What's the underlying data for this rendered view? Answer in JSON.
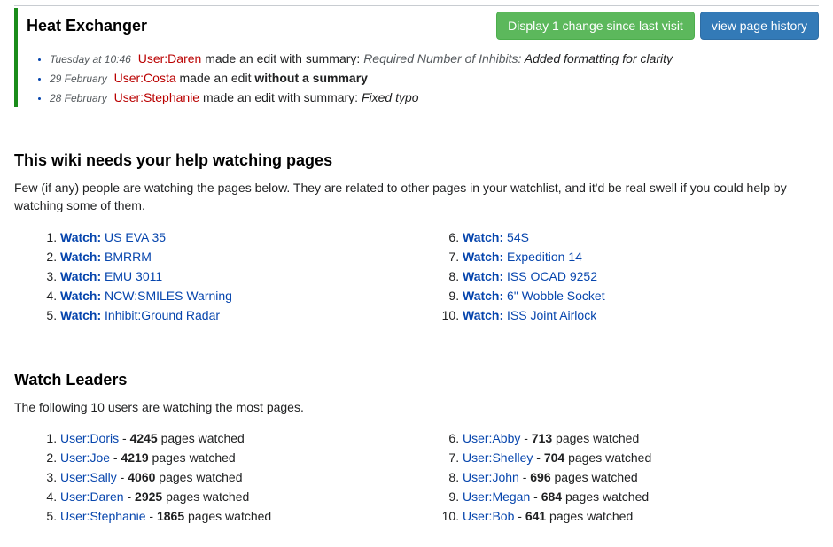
{
  "article": {
    "title": "Heat Exchanger",
    "btn_changes": "Display 1 change since last visit",
    "btn_history": "view page history",
    "edits": [
      {
        "ts": "Tuesday at 10:46",
        "user": "User:Daren",
        "mid": " made an edit with summary:  ",
        "no_summary": "",
        "summary_pre": "Required Number of Inhibits: ",
        "summary_suf": "Added formatting for clarity"
      },
      {
        "ts": "29 February",
        "user": "User:Costa",
        "mid": " made an edit ",
        "no_summary": "without a summary",
        "summary_pre": "",
        "summary_suf": ""
      },
      {
        "ts": "28 February",
        "user": "User:Stephanie",
        "mid": " made an edit with summary:  ",
        "no_summary": "",
        "summary_pre": "",
        "summary_suf": "Fixed typo"
      }
    ]
  },
  "help": {
    "heading": "This wiki needs your help watching pages",
    "lead": "Few (if any) people are watching the pages below. They are related to other pages in your watchlist, and it'd be real swell if you could help by watching some of them.",
    "watch_label": "Watch:",
    "left": [
      "US EVA 35",
      "BMRRM",
      "EMU 3011",
      "NCW:SMILES Warning",
      "Inhibit:Ground Radar"
    ],
    "right": [
      "54S",
      "Expedition 14",
      "ISS OCAD 9252",
      "6\" Wobble Socket",
      "ISS Joint Airlock"
    ]
  },
  "leaders": {
    "heading": "Watch Leaders",
    "lead": "The following 10 users are watching the most pages.",
    "suffix": " pages watched",
    "left": [
      {
        "user": "User:Doris",
        "count": "4245"
      },
      {
        "user": "User:Joe",
        "count": "4219"
      },
      {
        "user": "User:Sally",
        "count": "4060"
      },
      {
        "user": "User:Daren",
        "count": "2925"
      },
      {
        "user": "User:Stephanie",
        "count": "1865"
      }
    ],
    "right": [
      {
        "user": "User:Abby",
        "count": "713"
      },
      {
        "user": "User:Shelley",
        "count": "704"
      },
      {
        "user": "User:John",
        "count": "696"
      },
      {
        "user": "User:Megan",
        "count": "684"
      },
      {
        "user": "User:Bob",
        "count": "641"
      }
    ]
  }
}
